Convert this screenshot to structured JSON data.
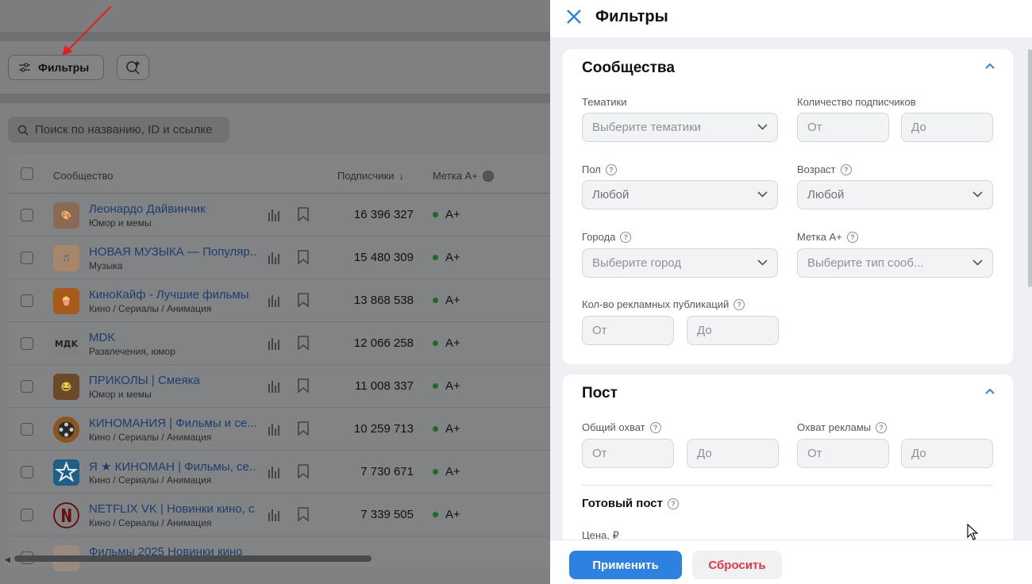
{
  "background_page": {
    "filters_button_label": "Фильтры",
    "search_placeholder": "Поиск по названию, ID и ссылке",
    "table_headers": {
      "community": "Сообщество",
      "subscribers": "Подписчики",
      "mark": "Метка А+"
    },
    "rows": [
      {
        "name": "Леонардо Дайвинчик",
        "category": "Юмор и мемы",
        "subscribers": "16 396 327",
        "mark": "A+"
      },
      {
        "name": "НОВАЯ МУЗЫКА — Популяр...",
        "category": "Музыка",
        "subscribers": "15 480 309",
        "mark": "A+"
      },
      {
        "name": "КиноКайф - Лучшие фильмы",
        "category": "Кино / Сериалы / Анимация",
        "subscribers": "13 868 538",
        "mark": "A+"
      },
      {
        "name": "MDK",
        "category": "Развлечения, юмор",
        "subscribers": "12 066 258",
        "mark": "A+",
        "avatar_text": "MДK"
      },
      {
        "name": "ПРИКОЛЫ | Смеяка",
        "category": "Юмор и мемы",
        "subscribers": "11 008 337",
        "mark": "A+"
      },
      {
        "name": "КИНОМАНИЯ | Фильмы и се...",
        "category": "Кино / Сериалы / Анимация",
        "subscribers": "10 259 713",
        "mark": "A+"
      },
      {
        "name": "Я ★ КИНОМАН | Фильмы, се...",
        "category": "Кино / Сериалы / Анимация",
        "subscribers": "7 730 671",
        "mark": "A+"
      },
      {
        "name": "NETFLIX VK | Новинки кино, с...",
        "category": "Кино / Сериалы / Анимация",
        "subscribers": "7 339 505",
        "mark": "A+"
      },
      {
        "name": "Фильмы 2025 Новинки кино",
        "category": "",
        "subscribers": "",
        "mark": ""
      }
    ]
  },
  "panel": {
    "title": "Фильтры",
    "communities": {
      "title": "Сообщества",
      "topics_label": "Тематики",
      "topics_placeholder": "Выберите тематики",
      "subscribers_count_label": "Количество подписчиков",
      "from": "От",
      "to": "До",
      "gender_label": "Пол",
      "gender_value": "Любой",
      "age_label": "Возраст",
      "age_value": "Любой",
      "cities_label": "Города",
      "cities_placeholder": "Выберите город",
      "mark_label": "Метка А+",
      "mark_placeholder": "Выберите тип сооб...",
      "ads_count_label": "Кол-во рекламных публикаций"
    },
    "post": {
      "title": "Пост",
      "total_reach_label": "Общий охват",
      "ad_reach_label": "Охват рекламы",
      "from": "От",
      "to": "До",
      "ready_post_label": "Готовый пост",
      "price_label": "Цена, ₽"
    },
    "footer": {
      "apply_label": "Применить",
      "reset_label": "Сбросить"
    }
  },
  "colors": {
    "accent": "#2d81e0",
    "reset": "#e0374a",
    "mark_dot": "#1c6b2c"
  }
}
